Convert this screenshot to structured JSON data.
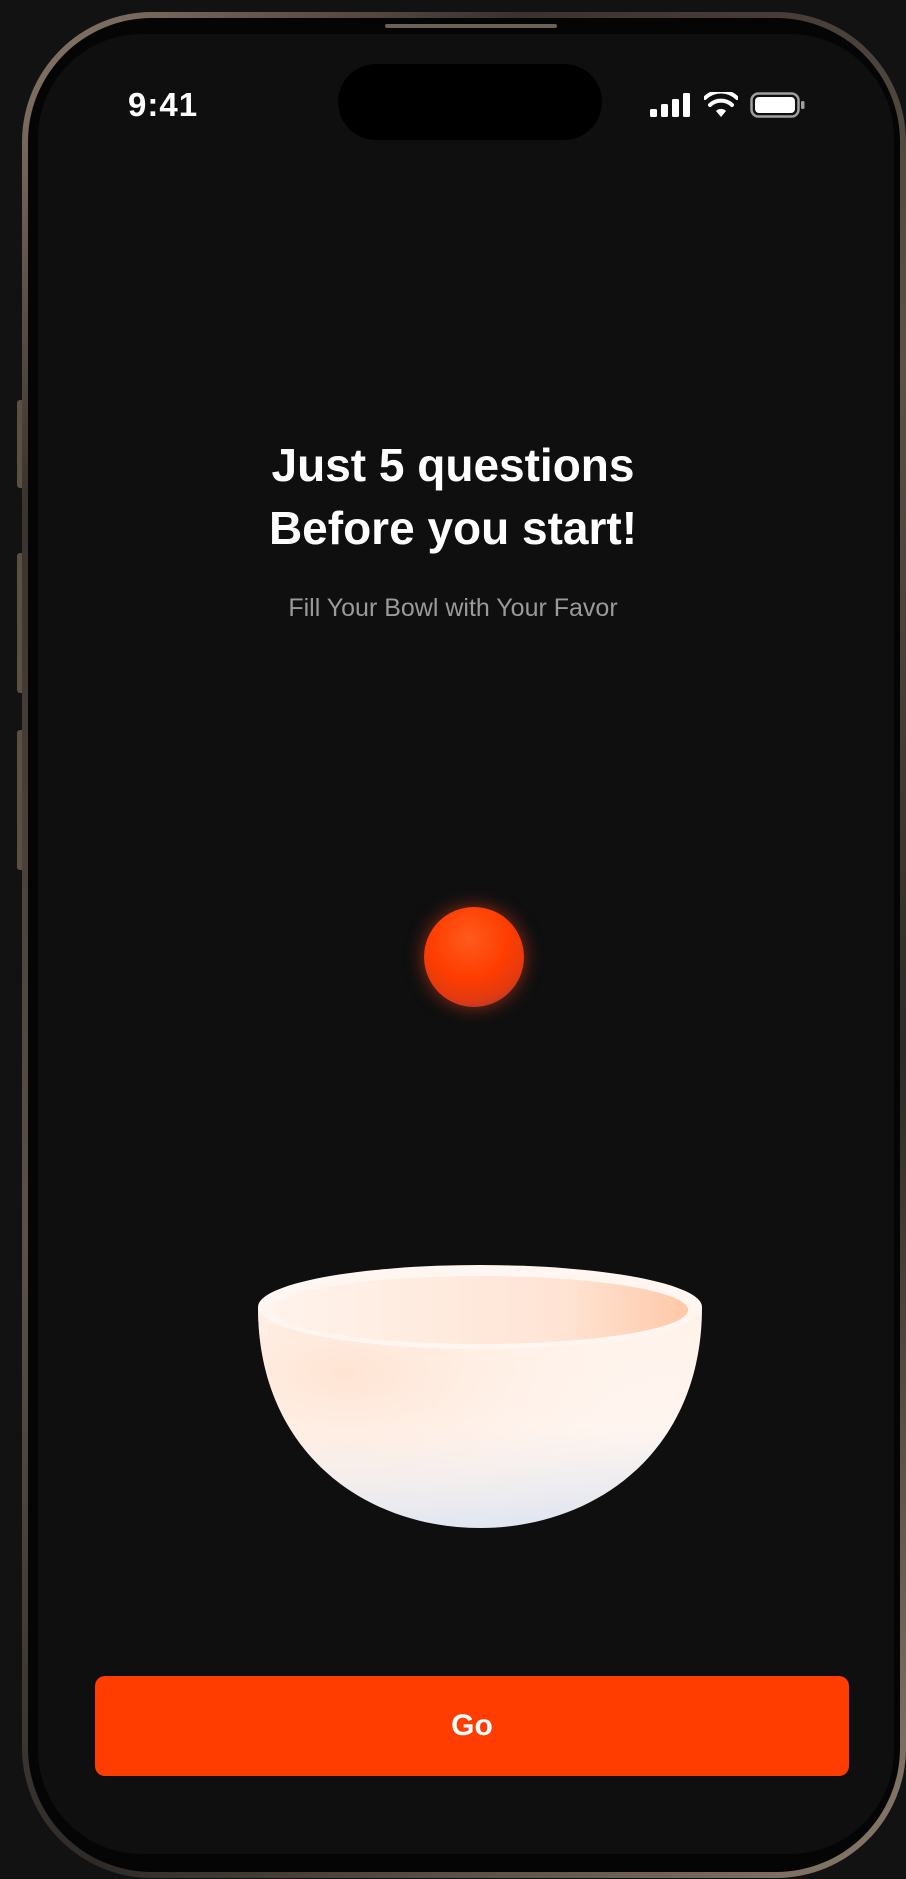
{
  "status_bar": {
    "time": "9:41",
    "icons": [
      "cellular-signal-icon",
      "wifi-icon",
      "battery-icon"
    ]
  },
  "intro": {
    "title_line1": "Just 5 questions",
    "title_line2": "Before you start!",
    "subtitle": "Fill Your Bowl with Your Favor"
  },
  "actions": {
    "go_label": "Go"
  },
  "colors": {
    "accent": "#ff3d00",
    "background": "#0f0f10",
    "title": "#ffffff",
    "subtitle": "#9a9a9a"
  }
}
